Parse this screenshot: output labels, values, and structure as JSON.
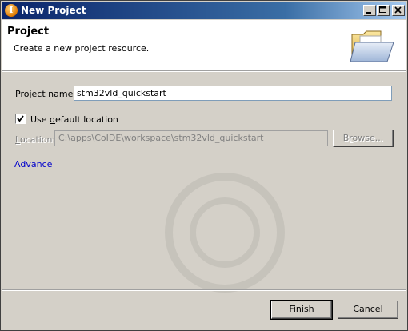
{
  "window": {
    "title": "New Project",
    "app_icon_letter": "I",
    "controls": {
      "minimize_icon": "minimize-icon",
      "maximize_icon": "maximize-icon",
      "close_icon": "close-icon"
    }
  },
  "banner": {
    "title": "Project",
    "description": "Create a new project resource.",
    "icon": "open-folder-icon"
  },
  "form": {
    "project_name_label_prefix": "P",
    "project_name_label_accel": "r",
    "project_name_label_suffix": "oject name:",
    "project_name_value": "stm32vld_quickstart",
    "use_default_checked": true,
    "use_default_label_prefix": "Use ",
    "use_default_label_accel": "d",
    "use_default_label_suffix": "efault location",
    "location_label_accel": "L",
    "location_label_suffix": "ocation:",
    "location_value": "C:\\apps\\CoIDE\\workspace\\stm32vld_quickstart",
    "browse_label_prefix": "B",
    "browse_label_accel": "r",
    "browse_label_suffix": "owse...",
    "advance_link": "Advance"
  },
  "footer": {
    "finish_accel": "F",
    "finish_suffix": "inish",
    "cancel_label": "Cancel"
  },
  "colors": {
    "titlebar_start": "#0a246a",
    "link": "#0000cc",
    "dialog_bg": "#d4d0c8"
  }
}
